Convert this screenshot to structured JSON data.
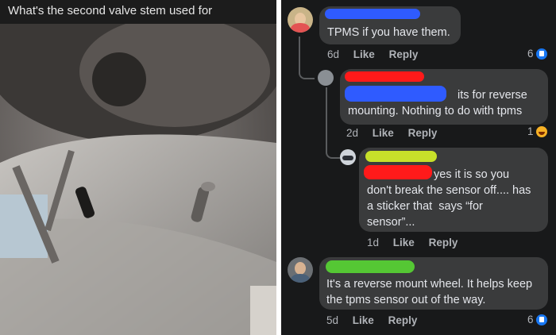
{
  "post": {
    "title": "What's the second valve stem used for"
  },
  "comments": [
    {
      "text": "TPMS if you have them.",
      "time": "6d",
      "like": "Like",
      "reply": "Reply",
      "reactions": "6",
      "reaction_type": "like-icon"
    },
    {
      "text_line1": "its for reverse",
      "text_line2": "mounting. Nothing to do with tpms",
      "time": "2d",
      "like": "Like",
      "reply": "Reply",
      "reactions": "1",
      "reaction_type": "haha-icon"
    },
    {
      "text_line1": "yes it is so you",
      "text_line2": "don't break the sensor off.... has",
      "text_line3": "a sticker that  says “for",
      "text_line4": "sensor”...",
      "time": "1d",
      "like": "Like",
      "reply": "Reply"
    },
    {
      "text_line1": "It's a reverse mount wheel. It helps keep",
      "text_line2": "the tpms sensor out of the way.",
      "time": "5d",
      "like": "Like",
      "reply": "Reply",
      "reactions": "6",
      "reaction_type": "like-icon"
    }
  ],
  "colors": {
    "bubble": "#3a3b3c",
    "background": "#18191a",
    "scribble_blue": "#2f5bff",
    "scribble_red": "#ff1a1a",
    "scribble_yellow": "#c7e02a",
    "scribble_green": "#55c734"
  }
}
